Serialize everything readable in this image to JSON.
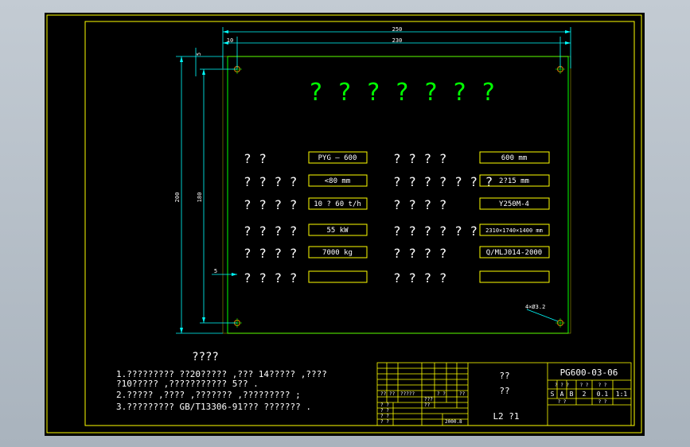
{
  "drawing": {
    "dimensions": {
      "width_total": "250",
      "width_inner": "230",
      "edge_offset": "10",
      "top_offset": "5",
      "height_total": "200",
      "height_inner": "180",
      "left_offset": "5"
    },
    "plate_title": "? ? ? ? ? ? ?",
    "hole_note": "4×Ø3.2",
    "spec_rows": [
      {
        "label_left": "?       ?",
        "value_left": "PYG — 600",
        "label_right": "? ? ? ?",
        "value_right": "600   mm"
      },
      {
        "label_left": "? ? ? ?",
        "value_left": "<80  mm",
        "label_right": "? ? ? ? ? ? ?",
        "value_right": "2?15 mm"
      },
      {
        "label_left": "? ? ? ?",
        "value_left": "10 ? 60 t/h",
        "label_right": "? ? ? ?",
        "value_right": "Y250M-4"
      },
      {
        "label_left": "? ? ? ?",
        "value_left": "55    kW",
        "label_right": "? ? ? ? ? ?",
        "value_right": "2310×1740×1400 mm"
      },
      {
        "label_left": "? ? ? ?",
        "value_left": "7000 kg",
        "label_right": "? ? ? ?",
        "value_right": "Q/MLJ014-2000"
      },
      {
        "label_left": "? ? ? ?",
        "value_left": "",
        "label_right": "? ? ? ?",
        "value_right": ""
      }
    ],
    "notes_title": "????",
    "notes": [
      "1.?????????   ??20?????  ,???  14?????  ,????",
      "  ?10?????   ,???????????       5??  .",
      "2.?????   ,????  ,???????     ,?????????     ;",
      "3.?????????      GB/T13306-91???  ???????     ."
    ]
  },
  "title_block": {
    "drawing_number": "PG600-03-06",
    "name_line_1": "??",
    "name_line_2": "??",
    "material": "L2  ?1",
    "stage_marks": [
      "S",
      "A",
      "B"
    ],
    "weight": "2",
    "scale": "0.1",
    "ratio": "1:1",
    "header_cells": [
      "? ? ?",
      "? ?",
      "? ?"
    ],
    "sheet_cells": [
      "? ?",
      "? ?"
    ],
    "revision_row": [
      "??",
      "??",
      "?????",
      "? ?",
      "??"
    ],
    "signature_rows": [
      "?  ?",
      "?  ?",
      "?  ?",
      "?  ?"
    ],
    "small_cells": [
      "???",
      "??"
    ],
    "date": "2000.8"
  },
  "colors": {
    "frame": "#ffff00",
    "plate": "#00ff00",
    "dimension": "#00ffff",
    "text": "#ffffff",
    "hole": "#c07000"
  }
}
